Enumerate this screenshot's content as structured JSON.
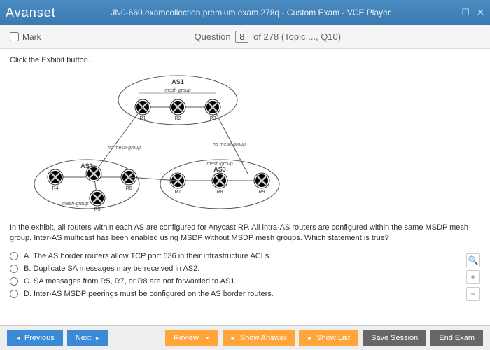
{
  "window": {
    "logo": "Avanset",
    "title": "JN0-660.examcollection.premium.exam.278q - Custom Exam - VCE Player"
  },
  "header": {
    "mark_label": "Mark",
    "question_label": "Question",
    "question_number": "8",
    "question_total": "of 278 (Topic ..., Q10)"
  },
  "content": {
    "instruction": "Click the Exhibit button.",
    "diagram": {
      "as1": "AS1",
      "as2": "AS2",
      "as3": "AS3",
      "mesh_group": "mesh-group",
      "no_mesh_group": "no mesh-group",
      "r1": "R1",
      "r2": "R2",
      "r3": "R3",
      "r4": "R4",
      "r5": "R5",
      "r6": "R6",
      "r7": "R7",
      "r8": "R8",
      "r9": "R9"
    },
    "question_text": "In the exhibit, all routers within each AS are configured for Anycast RP. All intra-AS routers are configured within the same MSDP mesh group. Inter-AS multicast has been enabled using MSDP without MSDP mesh groups. Which statement is true?",
    "answers": {
      "a": "A.  The AS border routers allow TCP port 636 in their infrastructure ACLs.",
      "b": "B.  Duplicate SA messages may be received in AS2.",
      "c": "C.  SA messages from R5, R7, or R8 are not forwarded to AS1.",
      "d": "D.  Inter-AS MSDP peerings must be configured on the AS border routers."
    }
  },
  "footer": {
    "previous": "Previous",
    "next": "Next",
    "review": "Review",
    "show_answer": "Show Answer",
    "show_list": "Show List",
    "save_session": "Save Session",
    "end_exam": "End Exam"
  },
  "zoom": {
    "search": "🔍",
    "plus": "+",
    "minus": "−"
  }
}
